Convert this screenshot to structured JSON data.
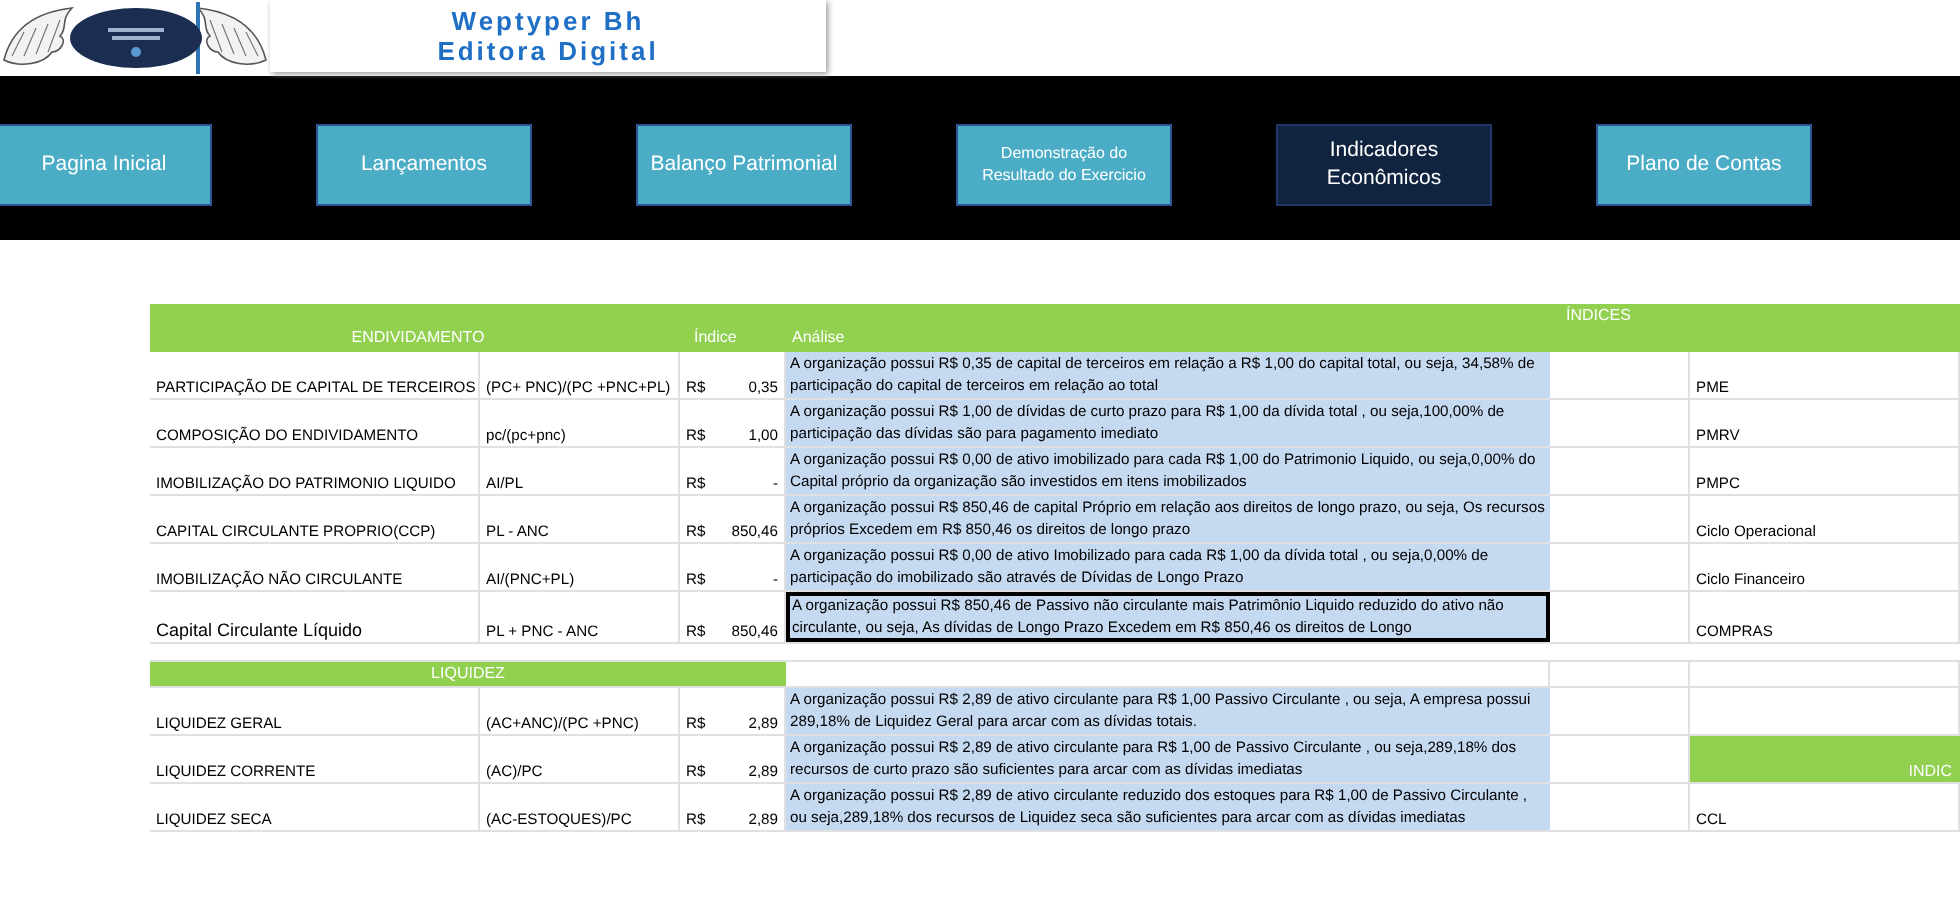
{
  "header": {
    "title_lines": [
      "Weptyper Bh",
      "Editora Digital"
    ]
  },
  "nav": [
    {
      "label": "Pagina Inicial",
      "selected": false
    },
    {
      "label": "Lançamentos",
      "selected": false
    },
    {
      "label": "Balanço Patrimonial",
      "selected": false
    },
    {
      "label": "Demonstração do Resultado do Exercicio",
      "selected": false
    },
    {
      "label": "Indicadores Econômicos",
      "selected": true
    },
    {
      "label": "Plano de Contas",
      "selected": false
    }
  ],
  "table": {
    "group_header": "ÍNDICES",
    "sections": [
      {
        "title": "ENDIVIDAMENTO",
        "columns": [
          "Índice",
          "Análise"
        ],
        "rows": [
          {
            "kind": "plain",
            "name": "PARTICIPAÇÃO DE CAPITAL DE TERCEIROS",
            "formula": " (PC+ PNC)/(PC +PNC+PL)",
            "currency": "R$",
            "value": "0,35",
            "analysis": " A organização possui  R$ 0,35 de capital de terceiros em relação a R$ 1,00 do capital total, ou seja, 34,58% de participação do capital de terceiros em relação ao total",
            "selected": false,
            "side": {
              "kind": "label",
              "text": "PME"
            }
          },
          {
            "kind": "plain",
            "name": "COMPOSIÇÃO DO ENDIVIDAMENTO",
            "formula": "pc/(pc+pnc)",
            "currency": "R$",
            "value": "1,00",
            "analysis": " A organização possui  R$ 1,00 de dívidas de curto prazo para  R$ 1,00 da dívida total , ou seja,100,00% de participação das dívidas são para pagamento imediato",
            "selected": false,
            "side": {
              "kind": "label",
              "text": "PMRV"
            }
          },
          {
            "kind": "plain",
            "name": "IMOBILIZAÇÃO DO PATRIMONIO LIQUIDO",
            "formula": "AI/PL",
            "currency": "R$",
            "value": "-",
            "analysis": " A organização possui  R$ 0,00 de ativo imobilizado  para cada  R$ 1,00 do Patrimonio Liquido, ou seja,0,00% do Capital próprio da organização são investidos em itens imobilizados",
            "selected": false,
            "side": {
              "kind": "label",
              "text": "PMPC"
            }
          },
          {
            "kind": "plain",
            "name": "CAPITAL CIRCULANTE PROPRIO(CCP)",
            "formula": "PL - ANC",
            "currency": "R$",
            "value": "850,46",
            "analysis": " A organização possui  R$ 850,46 de capital Próprio em relação aos direitos de longo prazo, ou seja, Os recursos próprios Excedem em R$ 850,46 os direitos de longo prazo",
            "selected": false,
            "side": {
              "kind": "label",
              "text": "Ciclo Operacional"
            }
          },
          {
            "kind": "plain",
            "name": "IMOBILIZAÇÃO NÃO CIRCULANTE",
            "formula": "AI/(PNC+PL)",
            "currency": "R$",
            "value": "-",
            "analysis": " A organização possui  R$ 0,00 de ativo Imobilizado para cada  R$ 1,00 da dívida total , ou seja,0,00% de participação do imobilizado são através de Dívidas de Longo Prazo",
            "selected": false,
            "side": {
              "kind": "label",
              "text": "Ciclo Financeiro"
            }
          },
          {
            "kind": "large",
            "name": "Capital Circulante Líquido",
            "formula": "PL + PNC - ANC",
            "currency": "R$",
            "value": "850,46",
            "analysis": " A organização possui  R$ 850,46 de Passivo não circulante mais Patrimônio Liquido reduzido do ativo não circulante, ou seja, As dívidas de Longo Prazo Excedem em R$ 850,46 os direitos de Longo",
            "selected": true,
            "side": {
              "kind": "label",
              "text": "COMPRAS"
            }
          }
        ]
      },
      {
        "title": "LIQUIDEZ",
        "rows": [
          {
            "kind": "plain",
            "name": "LIQUIDEZ GERAL",
            "formula": "(AC+ANC)/(PC +PNC)",
            "currency": "R$",
            "value": "2,89",
            "analysis": " A organização possui  R$ 2,89 de ativo circulante  para  R$ 1,00 Passivo Circulante , ou seja, A empresa possui  289,18% de Liquidez Geral para arcar com as dívidas totais.",
            "selected": false
          },
          {
            "kind": "plain",
            "name": "LIQUIDEZ CORRENTE",
            "formula": "(AC)/PC",
            "currency": "R$",
            "value": "2,89",
            "analysis": " A organização possui  R$ 2,89 de ativo circulante  para  R$ 1,00 de Passivo Circulante , ou seja,289,18% dos recursos de curto prazo são suficientes para arcar com as dívidas imediatas",
            "selected": false,
            "side": {
              "kind": "heading",
              "text": "INDIC"
            }
          },
          {
            "kind": "plain",
            "name": "LIQUIDEZ SECA",
            "formula": "(AC-ESTOQUES)/PC",
            "currency": "R$",
            "value": "2,89",
            "analysis": " A organização possui  R$ 2,89 de ativo circulante reduzido dos estoques para  R$ 1,00 de Passivo Circulante , ou seja,289,18% dos recursos de Liquidez seca são suficientes para arcar com as dívidas imediatas",
            "selected": false,
            "side": {
              "kind": "label",
              "text": "CCL"
            }
          }
        ]
      }
    ]
  }
}
